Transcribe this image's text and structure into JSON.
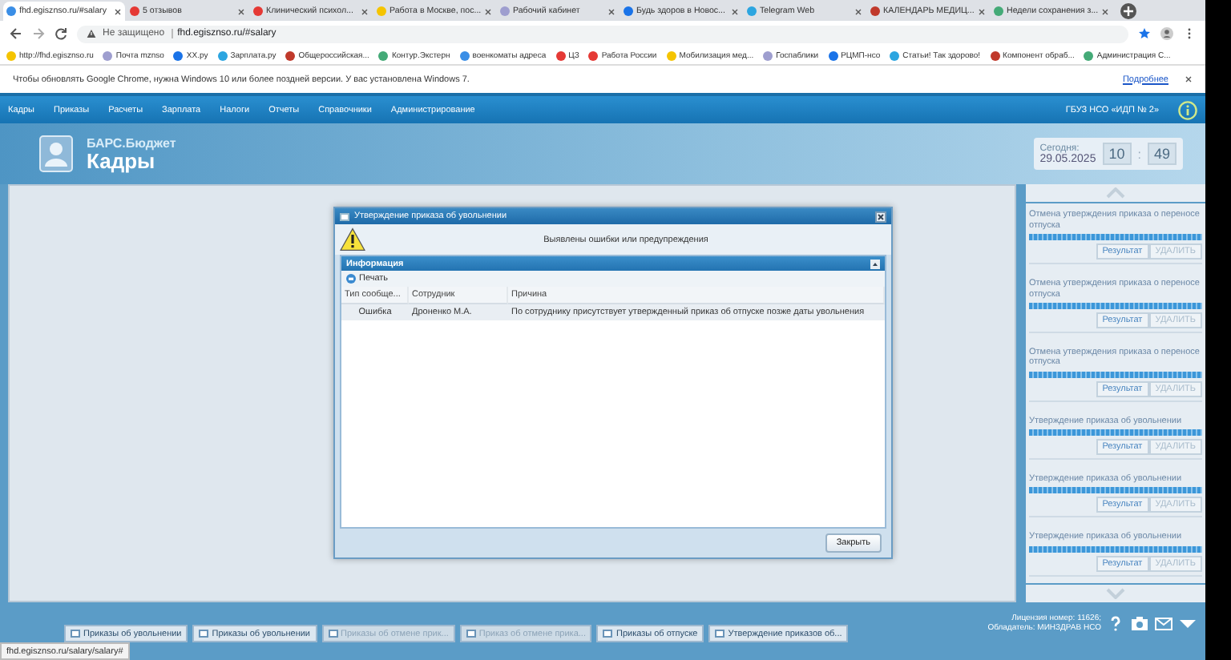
{
  "browser": {
    "tabs": [
      {
        "title": "fhd.egisznso.ru/#salary",
        "selected": true
      },
      {
        "title": "5 отзывов",
        "selected": false
      },
      {
        "title": "Клинический психол...",
        "selected": false
      },
      {
        "title": "Работа в Москве, пос...",
        "selected": false
      },
      {
        "title": "Рабочий кабинет",
        "selected": false
      },
      {
        "title": "Будь здоров в Новос...",
        "selected": false
      },
      {
        "title": "Telegram Web",
        "selected": false
      },
      {
        "title": "КАЛЕНДАРЬ МЕДИЦ...",
        "selected": false
      },
      {
        "title": "Недели сохранения з...",
        "selected": false
      }
    ],
    "address": {
      "security": "Не защищено",
      "url": "fhd.egisznso.ru/#salary"
    },
    "bookmarks": [
      "http://fhd.egisznso.ru",
      "Почта mznso",
      "ХХ.ру",
      "Зарплата.ру",
      "Общероссийская...",
      "Контур.Экстерн",
      "военкоматы адреса",
      "ЦЗ",
      "Работа России",
      "Мобилизация мед...",
      "Госпаблики",
      "РЦМП-нсо",
      "Статьи! Так здорово!",
      "Компонент обраб...",
      "Администрация С..."
    ],
    "infobar": {
      "message": "Чтобы обновлять Google Chrome, нужна Windows 10 или более поздней версии. У вас установлена Windows 7.",
      "link": "Подробнее"
    },
    "status_url": "fhd.egisznso.ru/salary/salary#"
  },
  "app": {
    "menu": [
      "Кадры",
      "Приказы",
      "Расчеты",
      "Зарплата",
      "Налоги",
      "Отчеты",
      "Справочники",
      "Администрирование"
    ],
    "organization": "ГБУЗ НСО «ИДП № 2»",
    "logo": {
      "line1": "БАРС.Бюджет",
      "line2": "Кадры"
    },
    "today": {
      "label": "Сегодня:",
      "date": "29.05.2025",
      "hours": "10",
      "separator": ":",
      "minutes": "49"
    }
  },
  "dialog": {
    "title": "Утверждение приказа об увольнении",
    "message": "Выявлены ошибки или предупреждения",
    "panel_title": "Информация",
    "toolbar_button": "Печать",
    "columns": [
      "Тип сообще...",
      "Сотрудник",
      "Причина"
    ],
    "rows": [
      [
        "Ошибка",
        "Дроненко М.А.",
        "По сотруднику присутствует утвержденный приказ об отпуске позже даты увольнения"
      ]
    ],
    "close_button": "Закрыть"
  },
  "tasks": [
    {
      "title": "Отмена утверждения приказа о переносе отпуска",
      "level": 1,
      "buttons": [
        {
          "label": "Результат",
          "disabled": false
        },
        {
          "label": "УДАЛИТЬ",
          "disabled": true
        }
      ]
    },
    {
      "title": "Отмена утверждения приказа о переносе отпуска",
      "level": 1,
      "buttons": [
        {
          "label": "Результат",
          "disabled": false
        },
        {
          "label": "УДАЛИТЬ",
          "disabled": true
        }
      ]
    },
    {
      "title": "Отмена утверждения приказа о переносе отпуска",
      "level": 1,
      "buttons": [
        {
          "label": "Результат",
          "disabled": false
        },
        {
          "label": "УДАЛИТЬ",
          "disabled": true
        }
      ]
    },
    {
      "title": "Утверждение приказа об увольнении",
      "level": 1,
      "buttons": [
        {
          "label": "Результат",
          "disabled": false
        },
        {
          "label": "УДАЛИТЬ",
          "disabled": true
        }
      ]
    },
    {
      "title": "Утверждение приказа об увольнении",
      "level": 1,
      "buttons": [
        {
          "label": "Результат",
          "disabled": false
        },
        {
          "label": "УДАЛИТЬ",
          "disabled": true
        }
      ]
    },
    {
      "title": "Утверждение приказа об увольнении",
      "level": 1,
      "buttons": [
        {
          "label": "Результат",
          "disabled": false
        },
        {
          "label": "УДАЛИТЬ",
          "disabled": true
        }
      ]
    }
  ],
  "taskbar": [
    {
      "label": "Приказы об увольнении",
      "disabled": false
    },
    {
      "label": "Приказы об увольнении",
      "disabled": false
    },
    {
      "label": "Приказы об отмене прик...",
      "disabled": true
    },
    {
      "label": "Приказ об отмене прика...",
      "disabled": true
    },
    {
      "label": "Приказы об отпуске",
      "disabled": false
    },
    {
      "label": "Утверждение приказов об...",
      "disabled": false
    }
  ],
  "license": "Лицензия номер: 11626; Обладатель: МИНЗДРАВ НСО"
}
